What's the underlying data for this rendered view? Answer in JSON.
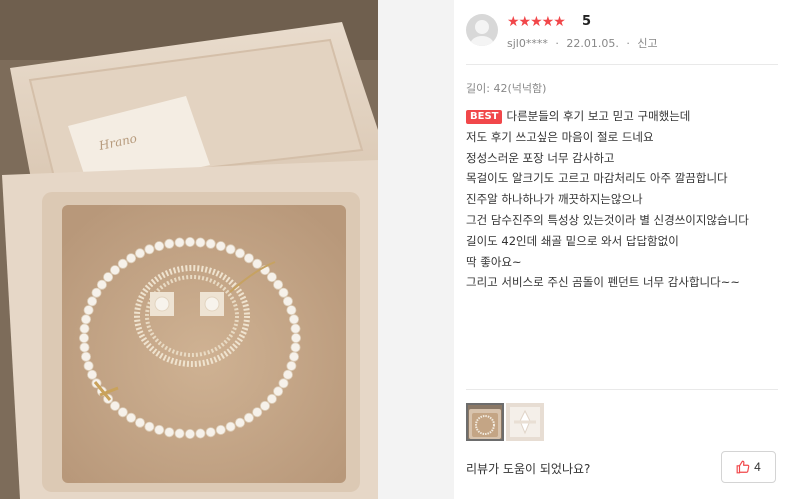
{
  "review": {
    "stars": "★★★★★",
    "rating": "5",
    "user": "sjl0****",
    "date": "22.01.05.",
    "separator": "·",
    "report_label": "신고",
    "option": "길이: 42(넉넉함)",
    "best_badge": "BEST",
    "lines": [
      "다른분들의 후기 보고 믿고 구매했는데",
      "저도 후기 쓰고싶은 마음이 절로 드네요",
      "정성스러운 포장 너무 감사하고",
      "목걸이도 알크기도 고르고 마감처리도 아주 깔끔합니다",
      "진주알 하나하나가 깨끗하지는않으나",
      "그건 담수진주의 특성상 있는것이라 별 신경쓰이지않습니다",
      "길이도 42인데 쇄골 밑으로 와서 답답함없이",
      "딱 좋아요~",
      "그리고 서비스로 주신 곰돌이 펜던트 너무 감사합니다~~"
    ],
    "helpful_question": "리뷰가 도움이 되었나요?",
    "like_count": "4"
  },
  "photo": {
    "box_logo": "Hrano"
  },
  "colors": {
    "accent": "#f1474a",
    "box_cream": "#e8d8c8",
    "velvet": "#c9aa8c"
  },
  "icons": {
    "avatar": "user-avatar-icon",
    "like": "thumbs-up-icon"
  }
}
